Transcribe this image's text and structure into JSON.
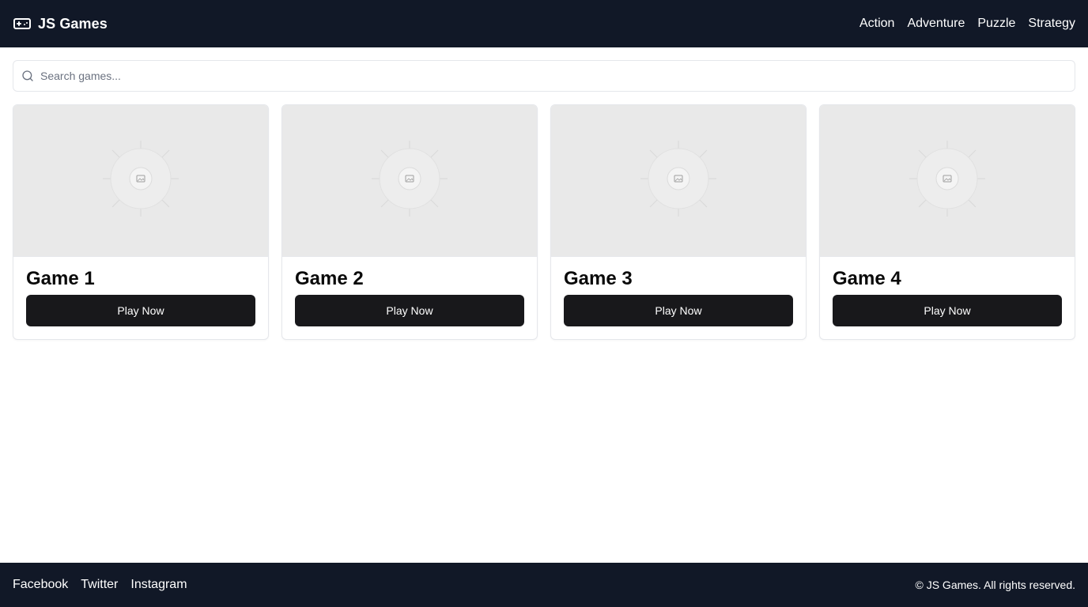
{
  "header": {
    "brand_icon": "gamepad-icon",
    "title": "JS Games",
    "nav": [
      {
        "label": "Action"
      },
      {
        "label": "Adventure"
      },
      {
        "label": "Puzzle"
      },
      {
        "label": "Strategy"
      }
    ],
    "background": "#111827"
  },
  "search": {
    "icon": "search-icon",
    "placeholder": "Search games...",
    "value": ""
  },
  "games": [
    {
      "title": "Game 1",
      "button": "Play Now",
      "thumbnail_icon": "image-placeholder-icon"
    },
    {
      "title": "Game 2",
      "button": "Play Now",
      "thumbnail_icon": "image-placeholder-icon"
    },
    {
      "title": "Game 3",
      "button": "Play Now",
      "thumbnail_icon": "image-placeholder-icon"
    },
    {
      "title": "Game 4",
      "button": "Play Now",
      "thumbnail_icon": "image-placeholder-icon"
    }
  ],
  "footer": {
    "social": [
      {
        "label": "Facebook"
      },
      {
        "label": "Twitter"
      },
      {
        "label": "Instagram"
      }
    ],
    "copyright": "© JS Games. All rights reserved.",
    "background": "#111827"
  },
  "colors": {
    "button": "#18181b",
    "thumbnail": "#e9e9e9",
    "border": "#e5e7eb"
  }
}
